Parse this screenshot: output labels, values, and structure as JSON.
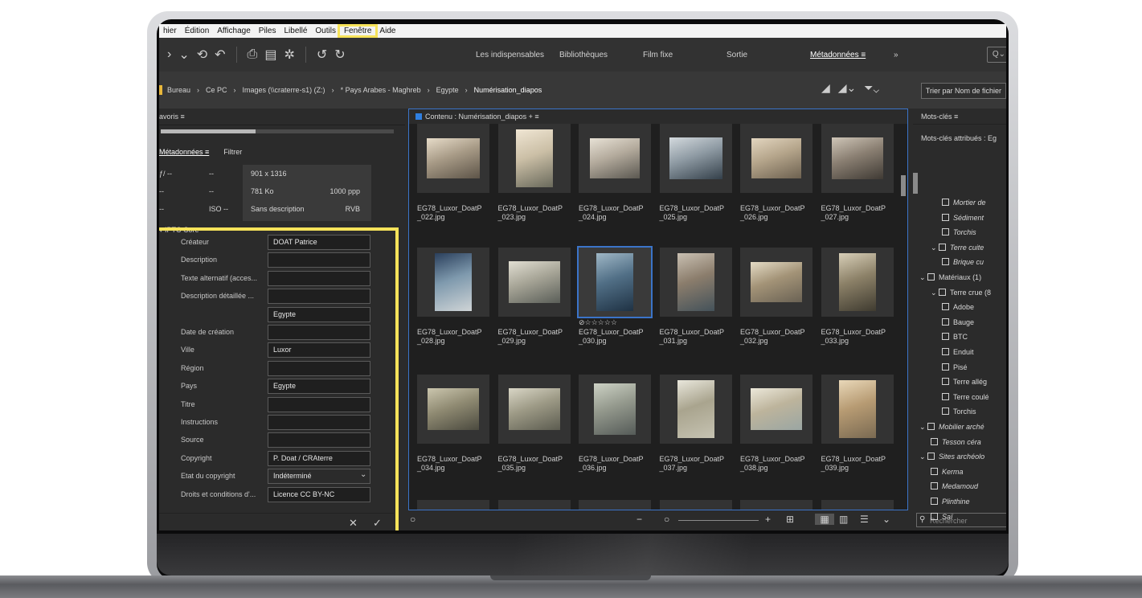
{
  "menu": {
    "items": [
      "hier",
      "Édition",
      "Affichage",
      "Piles",
      "Libellé",
      "Outils",
      "Fenêtre",
      "Aide"
    ],
    "highlighted": "Fenêtre"
  },
  "toolbar": {
    "workspaces": [
      "Les indispensables",
      "Bibliothèques",
      "Film fixe",
      "Sortie",
      "Métadonnées ≡",
      "»"
    ],
    "active_workspace": "Métadonnées ≡",
    "search_glyph": "Q⌄"
  },
  "path": {
    "crumbs": [
      "Bureau",
      "Ce PC",
      "Images (\\\\craterre-s1) (Z:)",
      "* Pays Arabes - Maghreb",
      "Egypte",
      "Numérisation_diapos"
    ],
    "sort_label": "Trier par Nom de fichier"
  },
  "favorites": {
    "title": "avoris ≡"
  },
  "metadata_tabs": {
    "metadata": "Métadonnées ≡",
    "filter": "Filtrer"
  },
  "exif": [
    [
      "ƒ/ --",
      "--"
    ],
    [
      "--",
      "--"
    ],
    [
      "--",
      "ISO --"
    ]
  ],
  "file_info": [
    [
      "901 x 1316",
      ""
    ],
    [
      "781 Ko",
      "1000 ppp"
    ],
    [
      "Sans description",
      "RVB"
    ]
  ],
  "iptc": {
    "section": "IPTC Core",
    "fields": [
      {
        "label": "Créateur",
        "value": "DOAT Patrice"
      },
      {
        "label": "Description",
        "value": ""
      },
      {
        "label": "Texte alternatif (acces...",
        "value": ""
      },
      {
        "label": "Description détaillée ...",
        "value": ""
      },
      {
        "label": "",
        "value": "Egypte"
      },
      {
        "label": "Date de création",
        "value": ""
      },
      {
        "label": "Ville",
        "value": "Luxor"
      },
      {
        "label": "Région",
        "value": ""
      },
      {
        "label": "Pays",
        "value": "Egypte"
      },
      {
        "label": "Titre",
        "value": ""
      },
      {
        "label": "Instructions",
        "value": ""
      },
      {
        "label": "Source",
        "value": ""
      },
      {
        "label": "Copyright",
        "value": "P. Doat / CRAterre"
      },
      {
        "label": "Etat du copyright",
        "value": "Indéterminé"
      },
      {
        "label": "Droits et conditions d'...",
        "value": "Licence CC BY-NC"
      }
    ],
    "cancel_glyph": "✕",
    "apply_glyph": "✓"
  },
  "content": {
    "title": "Contenu : Numérisation_diapos  +  ≡",
    "files": [
      [
        "EG78_Luxor_DoatP",
        "_022.jpg"
      ],
      [
        "EG78_Luxor_DoatP",
        "_023.jpg"
      ],
      [
        "EG78_Luxor_DoatP",
        "_024.jpg"
      ],
      [
        "EG78_Luxor_DoatP",
        "_025.jpg"
      ],
      [
        "EG78_Luxor_DoatP",
        "_026.jpg"
      ],
      [
        "EG78_Luxor_DoatP",
        "_027.jpg"
      ],
      [
        "EG78_Luxor_DoatP",
        "_028.jpg"
      ],
      [
        "EG78_Luxor_DoatP",
        "_029.jpg"
      ],
      [
        "EG78_Luxor_DoatP",
        "_030.jpg"
      ],
      [
        "EG78_Luxor_DoatP",
        "_031.jpg"
      ],
      [
        "EG78_Luxor_DoatP",
        "_032.jpg"
      ],
      [
        "EG78_Luxor_DoatP",
        "_033.jpg"
      ],
      [
        "EG78_Luxor_DoatP",
        "_034.jpg"
      ],
      [
        "EG78_Luxor_DoatP",
        "_035.jpg"
      ],
      [
        "EG78_Luxor_DoatP",
        "_036.jpg"
      ],
      [
        "EG78_Luxor_DoatP",
        "_037.jpg"
      ],
      [
        "EG78_Luxor_DoatP",
        "_038.jpg"
      ],
      [
        "EG78_Luxor_DoatP",
        "_039.jpg"
      ]
    ],
    "selected_index": 8,
    "rating_glyphs": "⊘☆☆☆☆☆"
  },
  "content_footer": {
    "minus": "−",
    "plus": "+"
  },
  "keywords": {
    "title": "Mots-clés ≡",
    "assigned": "Mots-clés attribués : Eg",
    "items": [
      {
        "text": "Mortier de",
        "italic": true,
        "indent": 2
      },
      {
        "text": "Sédiment",
        "italic": true,
        "indent": 2
      },
      {
        "text": "Torchis",
        "italic": true,
        "indent": 2
      },
      {
        "text": "Terre cuite",
        "italic": true,
        "indent": 1,
        "expand": true
      },
      {
        "text": "Brique cu",
        "italic": true,
        "indent": 2
      },
      {
        "text": "Matériaux (1)",
        "italic": false,
        "indent": 0,
        "expand": true
      },
      {
        "text": "Terre crue (8",
        "italic": false,
        "indent": 1,
        "expand": true
      },
      {
        "text": "Adobe",
        "italic": false,
        "indent": 2
      },
      {
        "text": "Bauge",
        "italic": false,
        "indent": 2
      },
      {
        "text": "BTC",
        "italic": false,
        "indent": 2
      },
      {
        "text": "Enduit",
        "italic": false,
        "indent": 2
      },
      {
        "text": "Pisé",
        "italic": false,
        "indent": 2
      },
      {
        "text": "Terre allég",
        "italic": false,
        "indent": 2
      },
      {
        "text": "Terre coulé",
        "italic": false,
        "indent": 2
      },
      {
        "text": "Torchis",
        "italic": false,
        "indent": 2
      },
      {
        "text": "Mobilier arché",
        "italic": true,
        "indent": 0,
        "expand": true
      },
      {
        "text": "Tesson céra",
        "italic": true,
        "indent": 1
      },
      {
        "text": "Sites archéolo",
        "italic": true,
        "indent": 0,
        "expand": true
      },
      {
        "text": "Kerma",
        "italic": true,
        "indent": 1
      },
      {
        "text": "Medamoud",
        "italic": true,
        "indent": 1
      },
      {
        "text": "Plinthine",
        "italic": true,
        "indent": 1
      },
      {
        "text": "Saï",
        "italic": true,
        "indent": 1
      }
    ],
    "search_placeholder": "Rechercher"
  },
  "colors": {
    "accent": "#3b74c9",
    "highlight": "#f7e35a",
    "panel": "#2b2b2b"
  }
}
